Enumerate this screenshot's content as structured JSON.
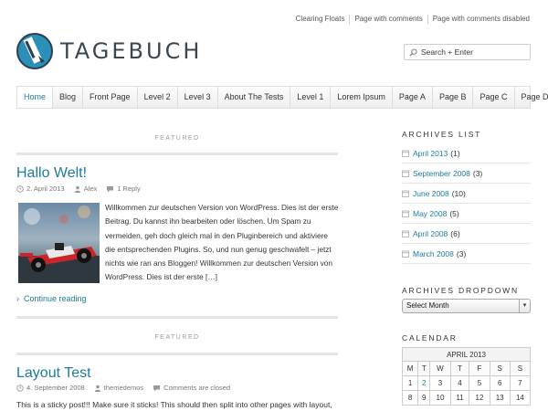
{
  "top_nav": [
    "Clearing Floats",
    "Page with comments",
    "Page with comments disabled"
  ],
  "site": {
    "title": "TAGEBUCH"
  },
  "search": {
    "placeholder": "Search + Enter"
  },
  "main_nav": [
    "Home",
    "Blog",
    "Front Page",
    "Level 2",
    "Level 3",
    "About The Tests",
    "Level 1",
    "Lorem Ipsum",
    "Page A",
    "Page B",
    "Page C",
    "Page D"
  ],
  "posts": [
    {
      "label": "FEATURED",
      "title": "Hallo Welt!",
      "date": "2. April 2013",
      "author": "Alex",
      "comments": "1 Reply",
      "excerpt": "Willkommen zur deutschen Version von WordPress. Dies ist der erste Beitrag. Du kannst ihn bearbeiten oder löschen. Um Spam zu vermeiden, geh doch gleich mal in den Pluginbereich und aktiviere die entsprechenden Plugins. So, und nun genug geschwafelt – jetzt nichts wie ran ans Bloggen! Willkommen zur deutschen Version von WordPress. Dies ist der erste […]",
      "continue": "Continue reading"
    },
    {
      "label": "FEATURED",
      "title": "Layout Test",
      "date": "4. September 2008",
      "author": "themedemos",
      "comments": "Comments are closed",
      "excerpt": "This is a sticky post!!! Make sure it sticks! This should then split into other pages with layout,"
    }
  ],
  "sidebar": {
    "archives_list_title": "ARCHIVES LIST",
    "archives": [
      {
        "label": "April 2013",
        "count": "(1)"
      },
      {
        "label": "September 2008",
        "count": "(3)"
      },
      {
        "label": "June 2008",
        "count": "(10)"
      },
      {
        "label": "May 2008",
        "count": "(5)"
      },
      {
        "label": "April 2008",
        "count": "(6)"
      },
      {
        "label": "March 2008",
        "count": "(3)"
      }
    ],
    "archives_dropdown_title": "ARCHIVES DROPDOWN",
    "dropdown_value": "Select Month",
    "calendar_title": "CALENDAR",
    "calendar": {
      "caption": "APRIL 2013",
      "weekdays": [
        "M",
        "T",
        "W",
        "T",
        "F",
        "S",
        "S"
      ],
      "rows": [
        [
          "1",
          "2",
          "3",
          "4",
          "5",
          "6",
          "7"
        ],
        [
          "8",
          "9",
          "10",
          "11",
          "12",
          "13",
          "14"
        ]
      ]
    }
  },
  "colors": {
    "link": "#1e7a9e",
    "nav_bg": "#eeeeee"
  }
}
